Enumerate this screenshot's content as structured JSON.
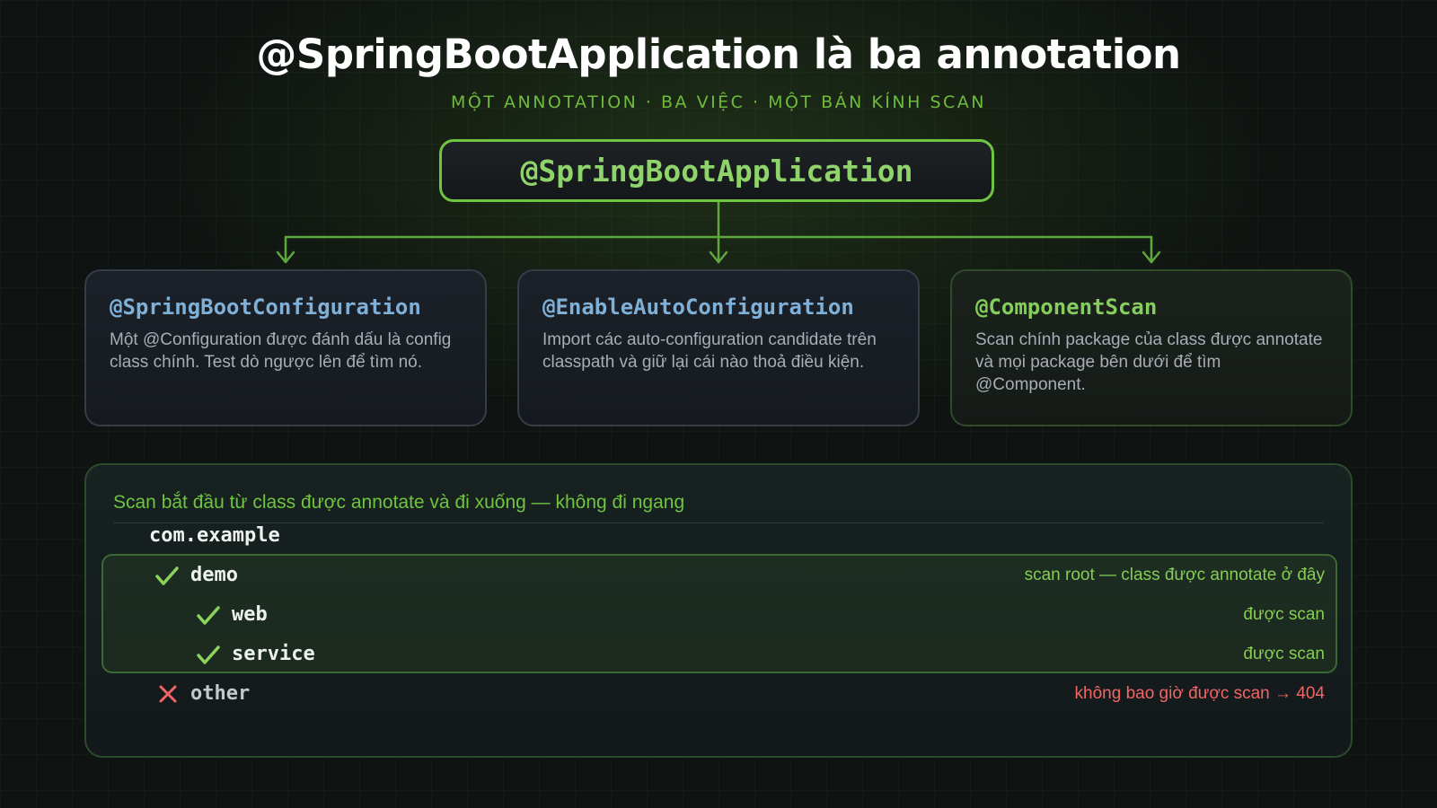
{
  "title": "@SpringBootApplication là ba annotation",
  "subtitle": "MỘT ANNOTATION · BA VIỆC · MỘT BÁN KÍNH SCAN",
  "root_annotation": "@SpringBootApplication",
  "colors": {
    "accent_green": "#6fc442",
    "annotation_blue": "#7fb0d8",
    "error_red": "#f26565",
    "background": "#0f1311"
  },
  "cards": [
    {
      "title": "@SpringBootConfiguration",
      "description": "Một @Configuration được đánh dấu là config class chính. Test dò ngược lên để tìm nó."
    },
    {
      "title": "@EnableAutoConfiguration",
      "description": "Import các auto-configuration candidate trên classpath và giữ lại cái nào thoả điều kiện."
    },
    {
      "title": "@ComponentScan",
      "description": "Scan chính package của class được annotate và mọi package bên dưới để tìm @Component."
    }
  ],
  "scan": {
    "heading": "Scan bắt đầu từ class được annotate và đi xuống — không đi ngang",
    "parent_package": "com.example",
    "packages": [
      {
        "name": "demo",
        "status": "check-icon",
        "note": "scan root — class được annotate ở đây"
      },
      {
        "name": "web",
        "status": "check-icon",
        "note": "được scan"
      },
      {
        "name": "service",
        "status": "check-icon",
        "note": "được scan"
      },
      {
        "name": "other",
        "status": "cross-icon",
        "note": "không bao giờ được scan → 404"
      }
    ]
  }
}
